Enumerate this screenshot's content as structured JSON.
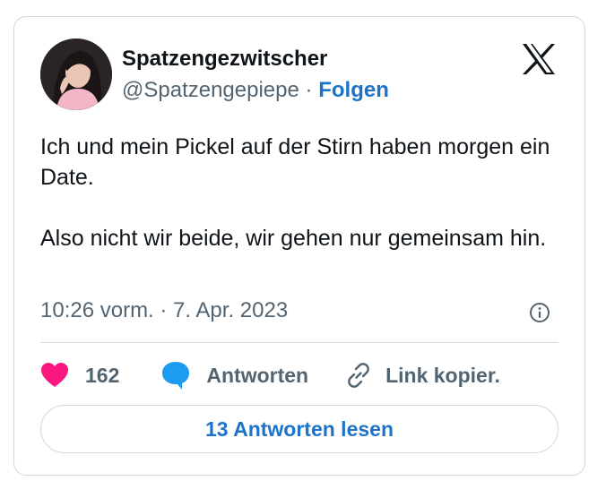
{
  "author": {
    "display_name": "Spatzengezwitscher",
    "handle": "@Spatzengepiepe",
    "separator": "·",
    "follow_label": "Folgen"
  },
  "tweet": {
    "paragraphs": [
      "Ich und mein Pickel auf der Stirn haben morgen ein Date.",
      "Also nicht wir beide, wir gehen nur gemeinsam hin."
    ],
    "timestamp": "10:26 vorm. · 7. Apr. 2023"
  },
  "actions": {
    "like_count": "162",
    "reply_label": "Antworten",
    "copy_link_label": "Link kopier."
  },
  "read_replies_label": "13 Antworten lesen",
  "icons": {
    "brand": "x-logo-icon",
    "like": "heart-icon",
    "reply": "speech-bubble-icon",
    "copy_link": "link-icon",
    "info": "info-icon"
  },
  "colors": {
    "text": "#0f1419",
    "secondary_text": "#536471",
    "link": "#1d73c8",
    "like": "#f91880",
    "reply": "#1d9bf0",
    "border": "#cfd9de"
  }
}
